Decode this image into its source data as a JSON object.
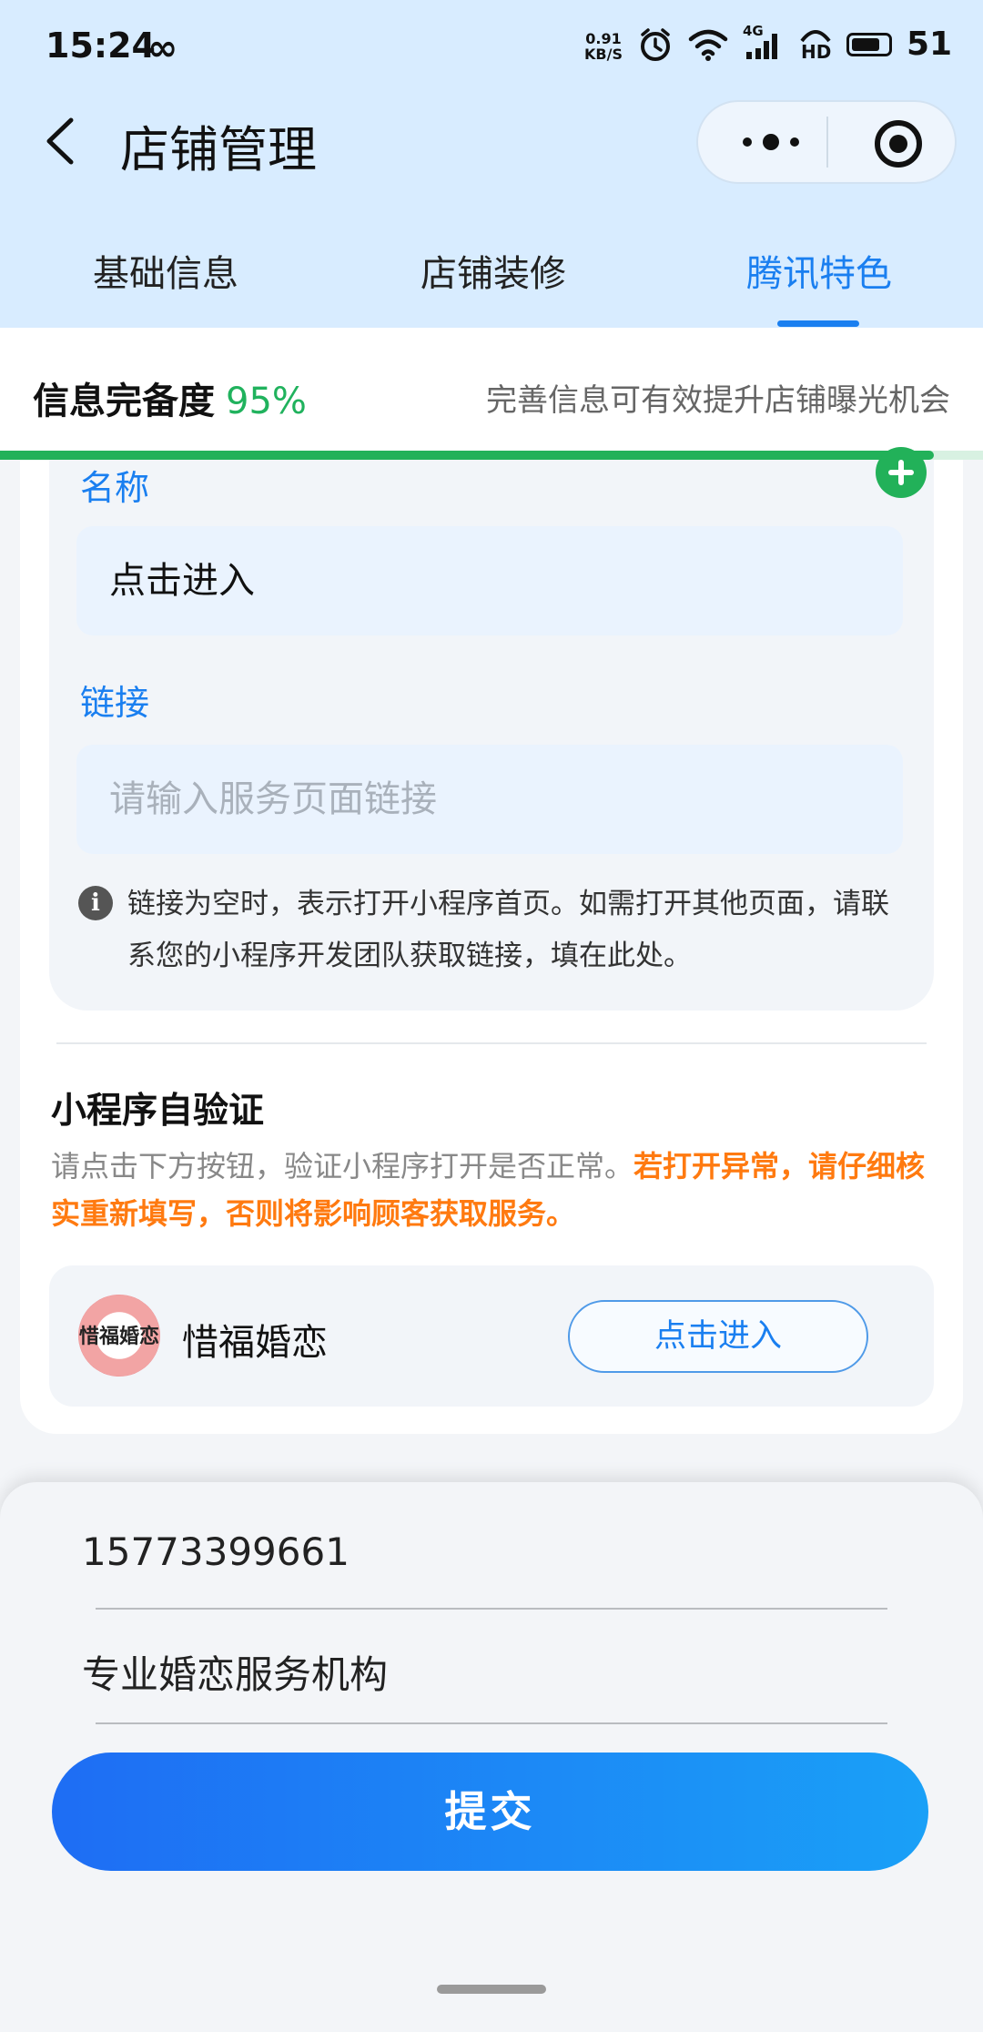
{
  "status_bar": {
    "time": "15:24",
    "infinity_symbol": "∞",
    "net_speed_value": "0.91",
    "net_speed_unit": "KB/S",
    "network_label": "4G",
    "hd_label": "HD",
    "battery_level": "51"
  },
  "nav": {
    "back_icon": "chevron-left",
    "title": "店铺管理",
    "more_icon": "more-dots",
    "close_icon": "target-circle"
  },
  "tabs": [
    {
      "label": "基础信息",
      "active": false
    },
    {
      "label": "店铺装修",
      "active": false
    },
    {
      "label": "腾讯特色",
      "active": true
    }
  ],
  "completeness": {
    "label": "信息完备度",
    "value": "95%",
    "progress_fraction": 0.95,
    "hint": "完善信息可有效提升店铺曝光机会"
  },
  "link_card": {
    "name_label": "名称",
    "name_value": "点击进入",
    "link_label": "链接",
    "link_placeholder": "请输入服务页面链接",
    "info_icon": "info-circle",
    "info_text": "链接为空时，表示打开小程序首页。如需打开其他页面，请联系您的小程序开发团队获取链接，填在此处。"
  },
  "verify": {
    "title": "小程序自验证",
    "desc_normal": "请点击下方按钮，验证小程序打开是否正常。",
    "desc_warning": "若打开异常，请仔细核实重新填写，否则将影响顾客获取服务。",
    "app_logo_text": "惜福婚恋",
    "app_name": "惜福婚恋",
    "button_label": "点击进入"
  },
  "sheet": {
    "phone": "15773399661",
    "tagline": "专业婚恋服务机构",
    "submit_label": "提交"
  },
  "colors": {
    "accent_blue": "#1a7ff0",
    "progress_green": "#22b159",
    "warning_orange": "#ff7a10",
    "header_bg": "#d8ecff"
  }
}
